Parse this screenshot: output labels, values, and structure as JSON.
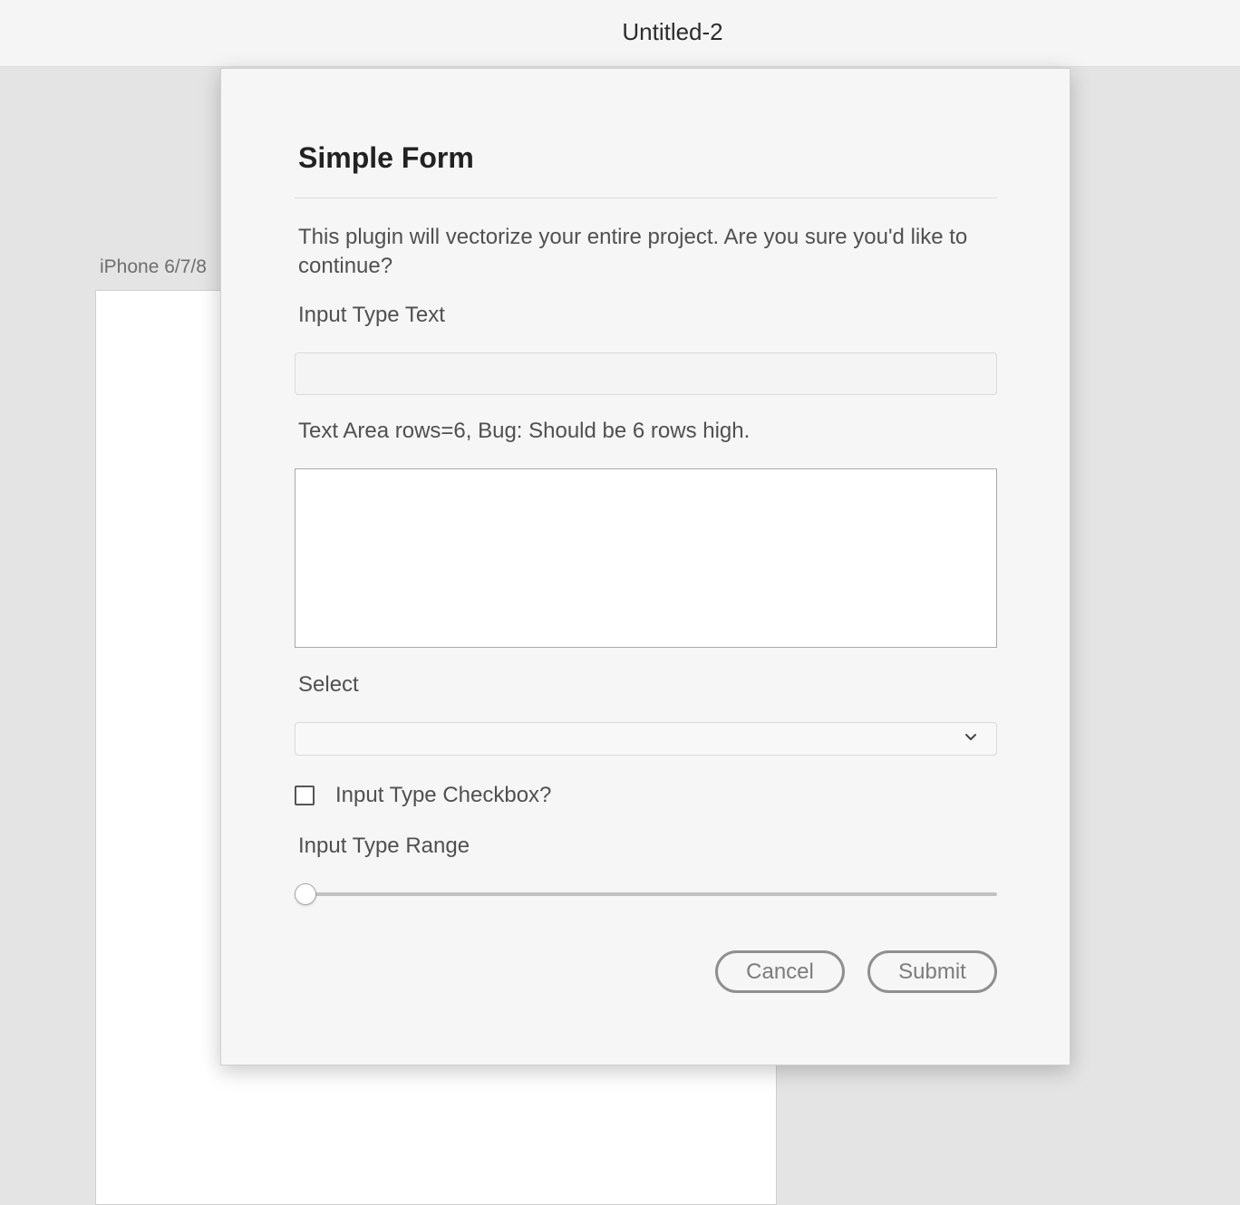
{
  "window": {
    "title": "Untitled-2"
  },
  "artboard": {
    "label": "iPhone 6/7/8"
  },
  "dialog": {
    "title": "Simple Form",
    "description": "This plugin will vectorize your entire project. Are you sure you'd like to continue?",
    "text_input": {
      "label": "Input Type Text",
      "value": ""
    },
    "textarea": {
      "label": "Text Area rows=6, Bug: Should be 6 rows high.",
      "value": ""
    },
    "select": {
      "label": "Select",
      "selected": "",
      "icon": "chevron-down-icon"
    },
    "checkbox": {
      "label": "Input Type Checkbox?",
      "checked": false
    },
    "range": {
      "label": "Input Type Range",
      "value_fraction": 0
    },
    "buttons": {
      "cancel": "Cancel",
      "submit": "Submit"
    }
  },
  "colors": {
    "canvas_bg": "#e4e4e4",
    "dialog_bg": "#f6f6f6",
    "button_border": "#8f8f8f"
  }
}
